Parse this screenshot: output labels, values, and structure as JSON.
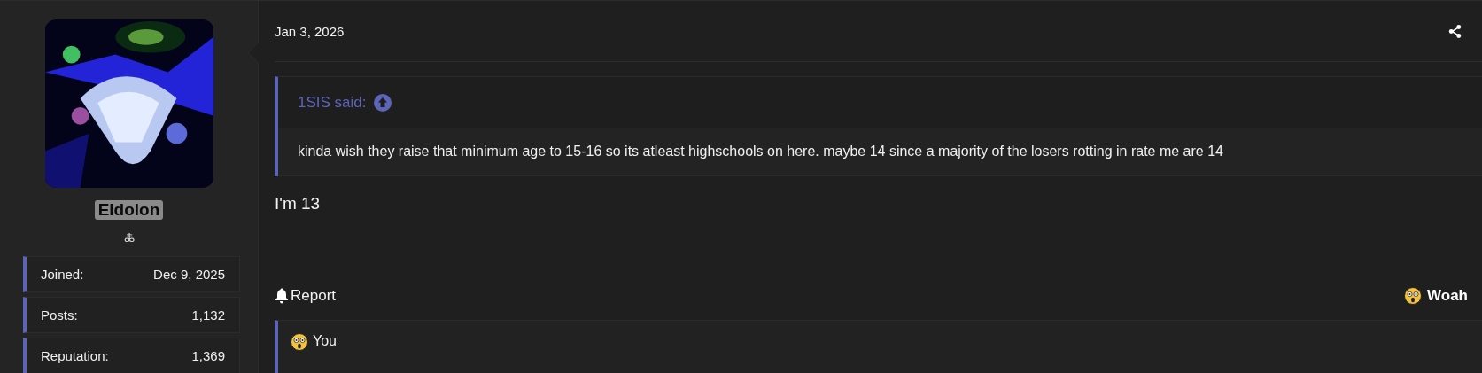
{
  "user": {
    "name": "Eidolon",
    "symbol": "🜏",
    "stats": [
      {
        "label": "Joined:",
        "value": "Dec 9, 2025"
      },
      {
        "label": "Posts:",
        "value": "1,132"
      },
      {
        "label": "Reputation:",
        "value": "1,369"
      }
    ]
  },
  "post": {
    "date": "Jan 3, 2026",
    "quote": {
      "author": "1SIS said:",
      "text": "kinda wish they raise that minimum age to 15-16 so its atleast highschools on here. maybe 14 since a majority of the losers rotting in rate me are 14"
    },
    "body": "I'm 13",
    "report": "Report",
    "reaction": {
      "label": "Woah"
    },
    "reactions_bar": {
      "label": "You"
    }
  }
}
